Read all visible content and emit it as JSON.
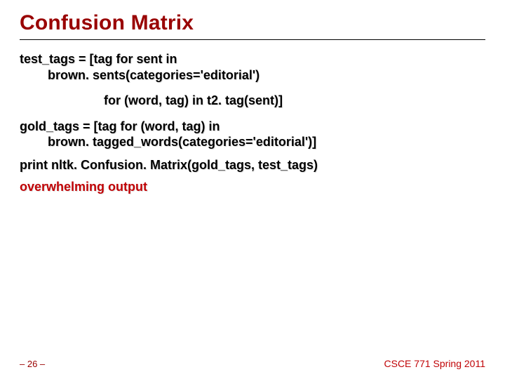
{
  "title": "Confusion Matrix",
  "lines": {
    "l1a": "test_tags = [tag for sent in",
    "l1b": "brown. sents(categories='editorial')",
    "l2": "for (word, tag) in t2. tag(sent)]",
    "l3a": "gold_tags = [tag for (word, tag) in",
    "l3b": "brown. tagged_words(categories='editorial')]",
    "l4": "print nltk. Confusion. Matrix(gold_tags, test_tags)",
    "emph": "overwhelming output"
  },
  "footer": {
    "page": "– 26 –",
    "course": "CSCE 771 Spring 2011"
  }
}
